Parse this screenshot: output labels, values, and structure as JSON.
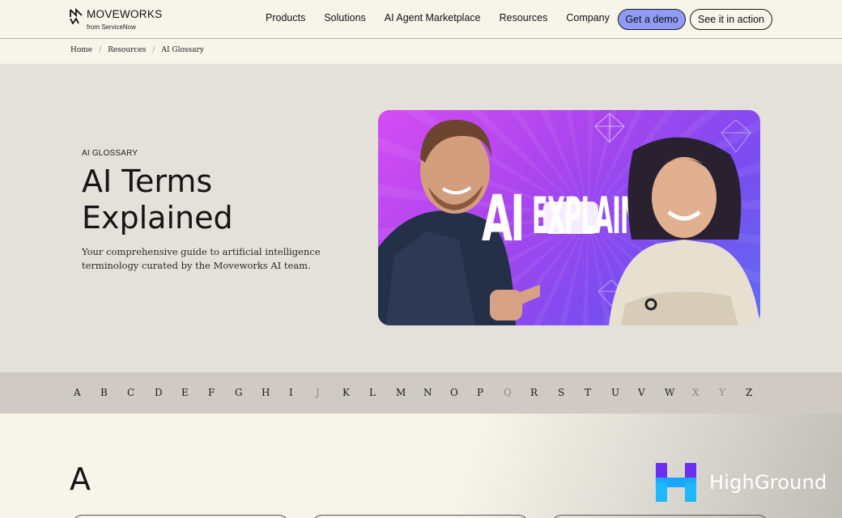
{
  "header": {
    "logo_name": "MOVEWORKS",
    "logo_sub": "from ServiceNow",
    "nav": [
      "Products",
      "Solutions",
      "AI Agent Marketplace",
      "Resources",
      "Company"
    ],
    "demo_label": "Get a demo",
    "action_label": "See it in action"
  },
  "breadcrumb": [
    "Home",
    "Resources",
    "AI Glossary"
  ],
  "hero": {
    "eyebrow": "AI GLOSSARY",
    "title_line1": "AI Terms",
    "title_line2": "Explained",
    "description": "Your comprehensive guide to artificial intelligence terminology curated by the Moveworks AI team.",
    "video_word1": "AI",
    "video_word2": "EXPLAINED"
  },
  "alphabet": [
    {
      "letter": "A",
      "enabled": true
    },
    {
      "letter": "B",
      "enabled": true
    },
    {
      "letter": "C",
      "enabled": true
    },
    {
      "letter": "D",
      "enabled": true
    },
    {
      "letter": "E",
      "enabled": true
    },
    {
      "letter": "F",
      "enabled": true
    },
    {
      "letter": "G",
      "enabled": true
    },
    {
      "letter": "H",
      "enabled": true
    },
    {
      "letter": "I",
      "enabled": true
    },
    {
      "letter": "J",
      "enabled": false
    },
    {
      "letter": "K",
      "enabled": true
    },
    {
      "letter": "L",
      "enabled": true
    },
    {
      "letter": "M",
      "enabled": true
    },
    {
      "letter": "N",
      "enabled": true
    },
    {
      "letter": "O",
      "enabled": true
    },
    {
      "letter": "P",
      "enabled": true
    },
    {
      "letter": "Q",
      "enabled": false
    },
    {
      "letter": "R",
      "enabled": true
    },
    {
      "letter": "S",
      "enabled": true
    },
    {
      "letter": "T",
      "enabled": true
    },
    {
      "letter": "U",
      "enabled": true
    },
    {
      "letter": "V",
      "enabled": true
    },
    {
      "letter": "W",
      "enabled": true
    },
    {
      "letter": "X",
      "enabled": false
    },
    {
      "letter": "Y",
      "enabled": false
    },
    {
      "letter": "Z",
      "enabled": true
    }
  ],
  "section": {
    "letter": "A"
  },
  "watermark": {
    "text": "HighGround",
    "icon": "highground-logo-icon"
  },
  "colors": {
    "accent": "#8f9bf6",
    "hero_bg": "#e4e0da",
    "alpha_bg": "#cfcac3",
    "page_bg": "#f7f4ea"
  }
}
